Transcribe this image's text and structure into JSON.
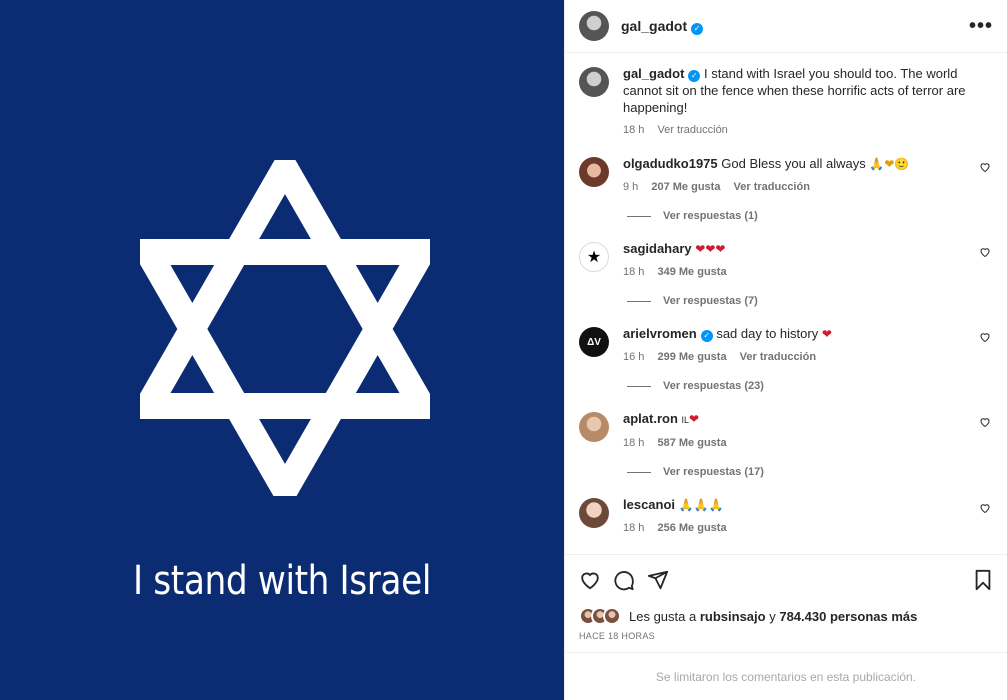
{
  "media": {
    "caption": "I stand with Israel",
    "bg_color": "#0b2c72"
  },
  "header": {
    "username": "gal_gadot",
    "more_label": "•••"
  },
  "post_caption": {
    "username": "gal_gadot",
    "text": "I stand with Israel you should too. The world cannot sit on the fence when these horrific acts of terror are happening!",
    "time": "18 h",
    "translate": "Ver traducción"
  },
  "comments": [
    {
      "username": "olgadudko1975",
      "text": "God Bless you all always",
      "emoji": "🙏❤🙂",
      "time": "9 h",
      "likes": "207 Me gusta",
      "translate": "Ver traducción",
      "replies": "Ver respuestas (1)"
    },
    {
      "username": "sagidahary",
      "text": "",
      "emoji": "❤❤❤",
      "time": "18 h",
      "likes": "349 Me gusta",
      "translate": "",
      "replies": "Ver respuestas (7)"
    },
    {
      "username": "arielvromen",
      "text": "sad day to history",
      "emoji": "❤",
      "time": "16 h",
      "likes": "299 Me gusta",
      "translate": "Ver traducción",
      "replies": "Ver respuestas (23)"
    },
    {
      "username": "aplat.ron",
      "text": "IL",
      "emoji": "❤",
      "time": "18 h",
      "likes": "587 Me gusta",
      "translate": "",
      "replies": "Ver respuestas (17)"
    },
    {
      "username": "lescanoi",
      "text": "",
      "emoji": "🙏🙏🙏",
      "time": "18 h",
      "likes": "256 Me gusta",
      "translate": "",
      "replies": ""
    }
  ],
  "likes_summary": {
    "prefix": "Les gusta a",
    "user": "rubsinsajo",
    "middle": "y",
    "count": "784.430 personas más"
  },
  "posted_ago": "HACE 18 HORAS",
  "footer_text": "Se limitaron los comentarios en esta publicación.",
  "ariel_avatar_text": "ΔV",
  "colors": {
    "verified": "#0095f6",
    "muted": "#737373"
  }
}
